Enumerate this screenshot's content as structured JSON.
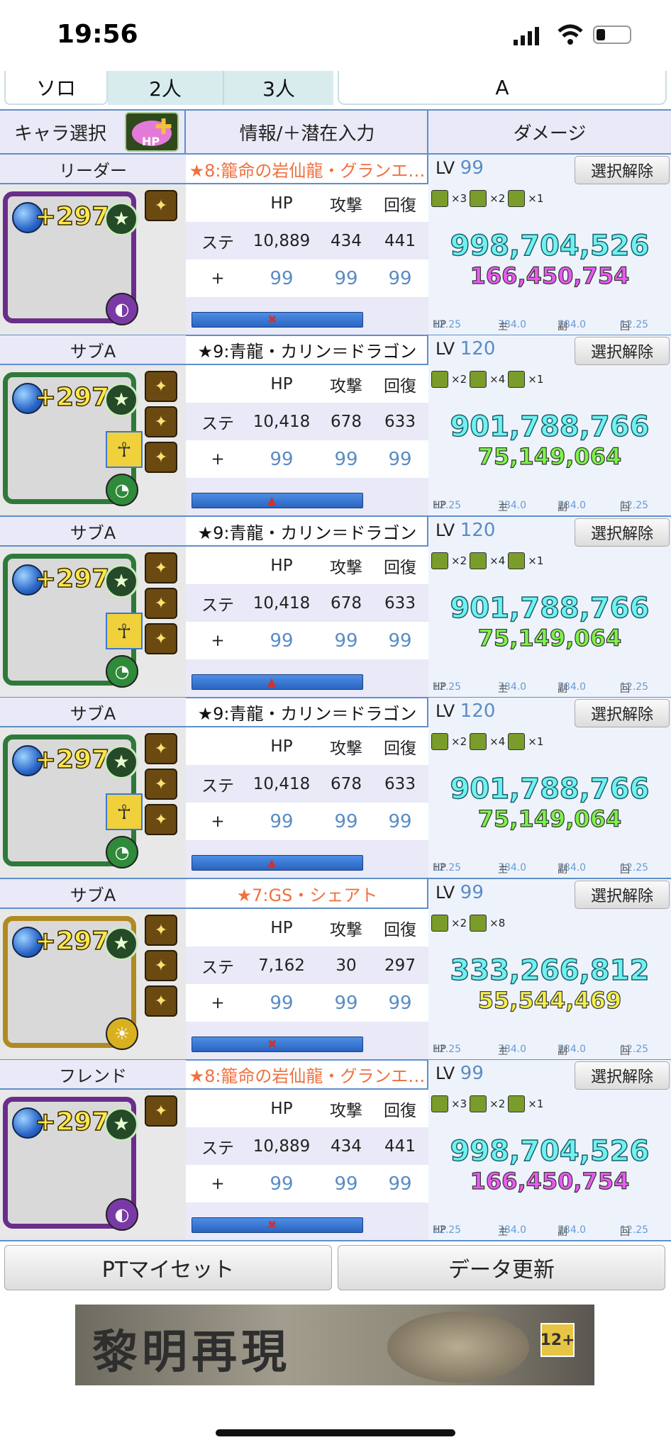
{
  "status": {
    "time": "19:56"
  },
  "tabs": [
    {
      "label": "ソロ"
    },
    {
      "label": "2人"
    },
    {
      "label": "3人"
    },
    {
      "label": "A"
    }
  ],
  "header": {
    "char_select": "キャラ選択",
    "hp_badge": "HP",
    "info": "情報/＋潜在入力",
    "damage": "ダメージ"
  },
  "col_labels": {
    "hp": "HP",
    "atk": "攻撃",
    "rcv": "回復",
    "stat": "ステ",
    "plus": "+"
  },
  "lv_label": "LV",
  "deselect_label": "選択解除",
  "mult_labels": {
    "hp": "HP",
    "main": "主",
    "sub": "副",
    "rcv": "回"
  },
  "rows": [
    {
      "role": "リーダー",
      "char": "★8:籠命の岩仙龍・グランエ…",
      "plus": "+297",
      "stats": {
        "hp": "10,889",
        "atk": "434",
        "rcv": "441"
      },
      "plus_vals": {
        "hp": "99",
        "atk": "99",
        "rcv": "99"
      },
      "lv": "99",
      "kills": [
        "×3",
        "×2",
        "×1"
      ],
      "main": "998,704,526",
      "sub": "166,450,754",
      "mult": {
        "hp": "12.25",
        "main": "784.0",
        "sub": "784.0",
        "rcv": "12.25"
      }
    },
    {
      "role": "サブA",
      "char": "★9:青龍・カリン＝ドラゴン",
      "plus": "+297",
      "stats": {
        "hp": "10,418",
        "atk": "678",
        "rcv": "633"
      },
      "plus_vals": {
        "hp": "99",
        "atk": "99",
        "rcv": "99"
      },
      "lv": "120",
      "kills": [
        "×2",
        "×4",
        "×1"
      ],
      "main": "901,788,766",
      "sub": "75,149,064",
      "mult": {
        "hp": "12.25",
        "main": "784.0",
        "sub": "784.0",
        "rcv": "12.25"
      }
    },
    {
      "role": "サブA",
      "char": "★9:青龍・カリン＝ドラゴン",
      "plus": "+297",
      "stats": {
        "hp": "10,418",
        "atk": "678",
        "rcv": "633"
      },
      "plus_vals": {
        "hp": "99",
        "atk": "99",
        "rcv": "99"
      },
      "lv": "120",
      "kills": [
        "×2",
        "×4",
        "×1"
      ],
      "main": "901,788,766",
      "sub": "75,149,064",
      "mult": {
        "hp": "12.25",
        "main": "784.0",
        "sub": "784.0",
        "rcv": "12.25"
      }
    },
    {
      "role": "サブA",
      "char": "★9:青龍・カリン＝ドラゴン",
      "plus": "+297",
      "stats": {
        "hp": "10,418",
        "atk": "678",
        "rcv": "633"
      },
      "plus_vals": {
        "hp": "99",
        "atk": "99",
        "rcv": "99"
      },
      "lv": "120",
      "kills": [
        "×2",
        "×4",
        "×1"
      ],
      "main": "901,788,766",
      "sub": "75,149,064",
      "mult": {
        "hp": "12.25",
        "main": "784.0",
        "sub": "784.0",
        "rcv": "12.25"
      }
    },
    {
      "role": "サブA",
      "char": "★7:GS・シェアト",
      "plus": "+297",
      "stats": {
        "hp": "7,162",
        "atk": "30",
        "rcv": "297"
      },
      "plus_vals": {
        "hp": "99",
        "atk": "99",
        "rcv": "99"
      },
      "lv": "99",
      "kills": [
        "×2",
        "×8"
      ],
      "main": "333,266,812",
      "sub": "55,544,469",
      "mult": {
        "hp": "12.25",
        "main": "784.0",
        "sub": "784.0",
        "rcv": "12.25"
      }
    },
    {
      "role": "フレンド",
      "char": "★8:籠命の岩仙龍・グランエ…",
      "plus": "+297",
      "stats": {
        "hp": "10,889",
        "atk": "434",
        "rcv": "441"
      },
      "plus_vals": {
        "hp": "99",
        "atk": "99",
        "rcv": "99"
      },
      "lv": "99",
      "kills": [
        "×3",
        "×2",
        "×1"
      ],
      "main": "998,704,526",
      "sub": "166,450,754",
      "mult": {
        "hp": "12.25",
        "main": "784.0",
        "sub": "784.0",
        "rcv": "12.25"
      }
    }
  ],
  "colors": {
    "char_title_orange": "#f07040",
    "sub_magenta": "#e85bf0",
    "sub_green": "#7cf24a",
    "sub_yellow": "#f3ef4a",
    "frame_purple": "#6a2e8a",
    "frame_green": "#2f7a3a",
    "frame_gold": "#b08a22"
  },
  "footer": {
    "pt_myset": "PTマイセット",
    "data_update": "データ更新"
  },
  "banner": {
    "text": "黎明再現",
    "age": "12+"
  }
}
